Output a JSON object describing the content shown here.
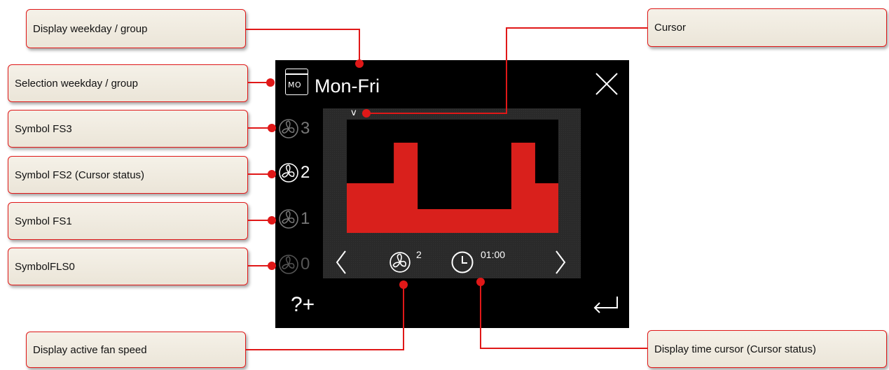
{
  "callouts": {
    "display_weekday_group": "Display weekday  / group",
    "selection_weekday_group": "Selection weekday / group",
    "symbol_fs3": "Symbol FS3",
    "symbol_fs2": "Symbol FS2 (Cursor status)",
    "symbol_fs1": "Symbol FS1",
    "symbol_fls0": "SymbolFLS0",
    "display_active_fan_speed": "Display active fan speed",
    "cursor": "Cursor",
    "display_time_cursor": "Display time cursor (Cursor status)"
  },
  "screen": {
    "weekday_icon_text": "MO",
    "title": "Mon-Fri",
    "fan_levels": [
      "3",
      "2",
      "1",
      "0"
    ],
    "active_fan_level_index": 1,
    "cursor_mark": "v",
    "active_fan_speed": "2",
    "cursor_time": "01:00",
    "help_label": "?+",
    "icons": {
      "weekday": "calendar-mo-icon",
      "close": "close-icon",
      "fan": "fan-icon",
      "prev": "chevron-left-icon",
      "next": "chevron-right-icon",
      "clock": "clock-icon",
      "enter": "enter-icon"
    },
    "schedule_levels": [
      1,
      1,
      3,
      0,
      0,
      0,
      0,
      3,
      1
    ],
    "colors": {
      "accent": "#e01818",
      "schedule_fill": "#d9201c",
      "screen_bg": "#000000",
      "panel_bg": "#2a2a2a",
      "fan_active": "#ffffff",
      "fan_inactive": "#777777",
      "fan_dim": "#555555"
    }
  }
}
